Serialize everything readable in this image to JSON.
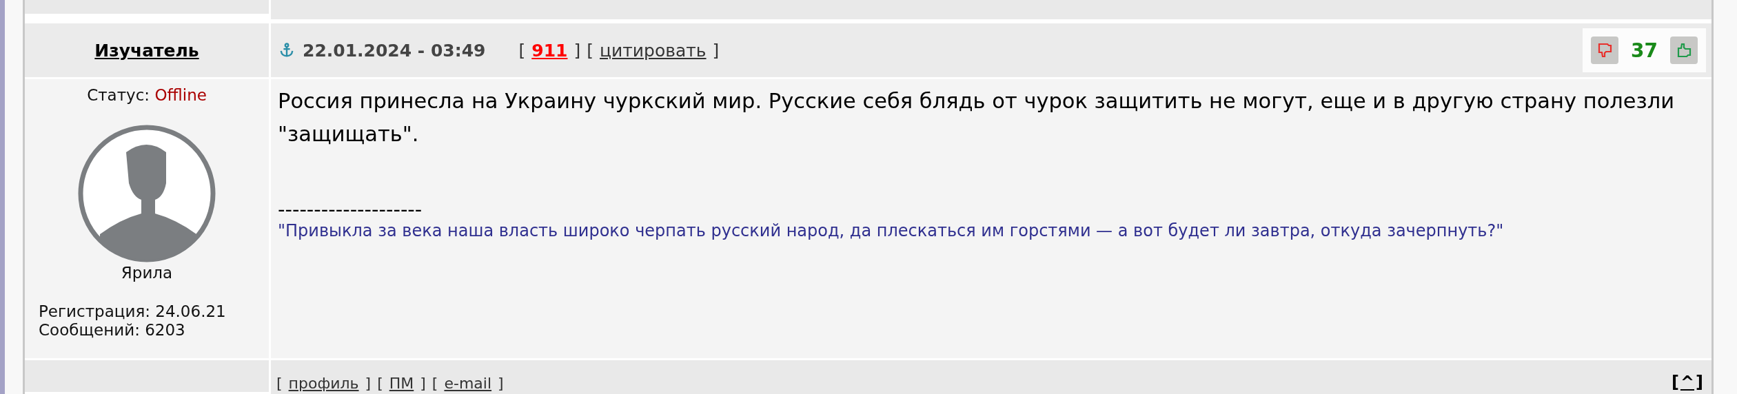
{
  "brackets": {
    "open": "[",
    "close": "]"
  },
  "post": {
    "author": {
      "name": "Изучатель",
      "status_label": "Статус:",
      "status": "Offline",
      "online": false,
      "avatar_caption": "Ярила",
      "registration": "Регистрация: 24.06.21",
      "messages": "Сообщений: 6203"
    },
    "date": "22.01.2024 - 03:49",
    "number": "911",
    "quote_link": "цитировать",
    "rating": "37",
    "text": "Россия принесла на Украину чуркский мир. Русские себя блядь от чурок защитить не могут, еще и в другую страну полезли \"защищать\".",
    "signature_rule": "--------------------",
    "signature": "\"Привыкла за века наша власть широко черпать русский народ, да плескаться им горстями — а вот будет ли завтра, откуда зачерпнуть?\""
  },
  "post_footer": {
    "links": [
      {
        "label": "профиль"
      },
      {
        "label": "ПМ"
      },
      {
        "label": "e-mail"
      }
    ],
    "top_link": "^"
  }
}
